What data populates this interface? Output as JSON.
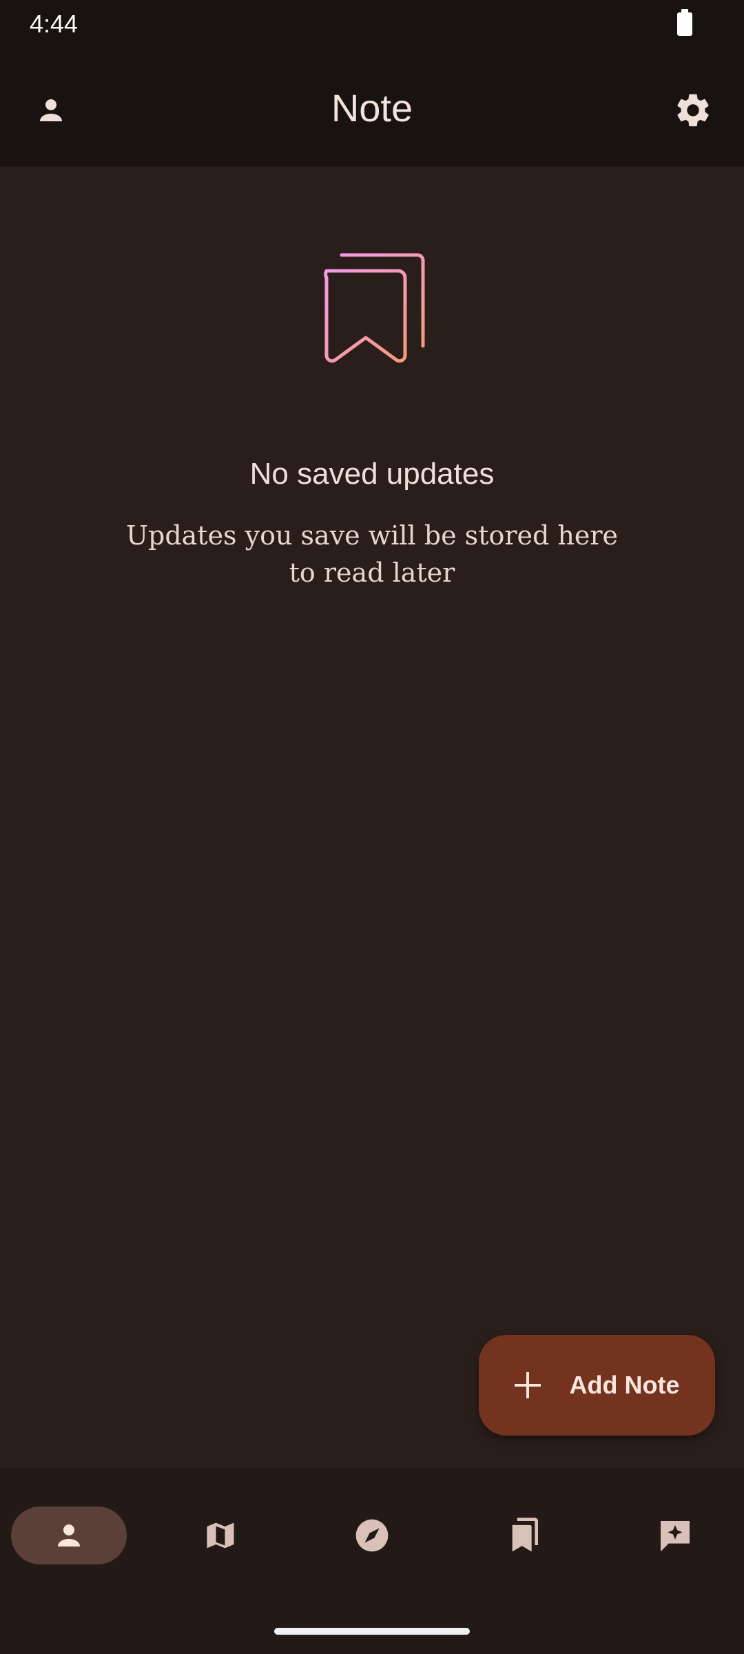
{
  "status_bar": {
    "time": "4:44"
  },
  "app_bar": {
    "title": "Note",
    "left_icon": "person-icon",
    "right_icon": "gear-icon"
  },
  "empty_state": {
    "icon": "bookmarks-icon",
    "title": "No saved updates",
    "subtitle": "Updates you save will be stored here to read later"
  },
  "fab": {
    "label": "Add Note",
    "icon": "plus-icon"
  },
  "bottom_nav": {
    "items": [
      {
        "icon": "person-icon",
        "active": true
      },
      {
        "icon": "map-icon",
        "active": false
      },
      {
        "icon": "compass-icon",
        "active": false
      },
      {
        "icon": "bookmarks-icon",
        "active": false
      },
      {
        "icon": "sparkle-chat-icon",
        "active": false
      }
    ]
  },
  "colors": {
    "background": "#2a1e1b",
    "app_bar": "#181210",
    "fab": "#74331f",
    "nav_active": "#5a4039",
    "icon_gradient_start": "#f59ae8",
    "icon_gradient_end": "#f59a7a"
  }
}
